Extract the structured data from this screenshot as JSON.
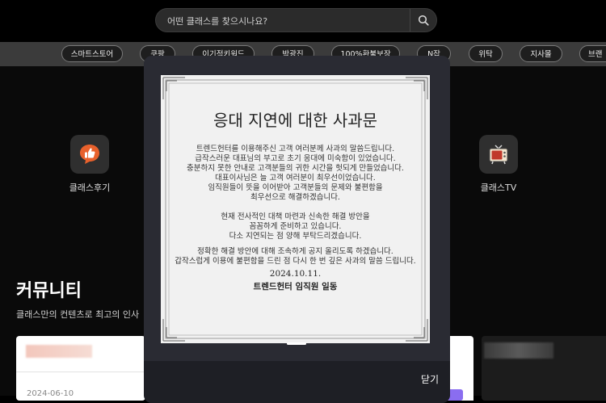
{
  "header": {
    "search": {
      "placeholder": "어떤 클래스를 찾으시나요?",
      "icon": "search-icon"
    }
  },
  "tags": [
    "스마트스토어",
    "쿠팡",
    "이기적키워드",
    "박광진",
    "100%환불보장",
    "N잡",
    "위탁",
    "지사몰",
    "브랜"
  ],
  "categories": [
    {
      "label": "클래스후기",
      "icon": "thumbs-up-icon",
      "color": "#e8612c"
    },
    {
      "label": "클래스TV",
      "icon": "tv-icon",
      "color": "#c0392b"
    }
  ],
  "community": {
    "title": "커뮤니티",
    "subtitle": "클래스만의 컨텐츠로 최고의 인사"
  },
  "cards": [
    {
      "date": "2024-06-10"
    }
  ],
  "modal": {
    "close_label": "닫기",
    "notice": {
      "title": "응대 지연에 대한 사과문",
      "paragraphs": [
        [
          "트렌드헌터를 이용해주신 고객 여러분께 사과의 말씀드립니다.",
          "급작스러운 대표님의 부고로 초기 응대에 미숙함이 있었습니다.",
          "충분하지 못한 안내로 고객분들의 귀한 시간을 헛되게 만들었습니다.",
          "대표이사님은 늘 고객 여러분이 최우선이었습니다.",
          "임직원들이 뜻을 이어받아 고객분들의 문제와 불편함을",
          "최우선으로 해결하겠습니다."
        ],
        [
          "현재 전사적인 대책 마련과 신속한 해결 방안을",
          "꼼꼼하게 준비하고 있습니다.",
          "다소 지연되는 점 양해 부탁드리겠습니다."
        ],
        [
          "정확한 해결 방안에 대해 조속하게 공지 올리도록 하겠습니다.",
          "갑작스럽게 이용에 불편함을 드린 점 다시 한 번 깊은 사과의 말씀 드립니다."
        ]
      ],
      "date": "2024.10.11.",
      "signature": "트렌드헌터 임직원 일동"
    }
  }
}
